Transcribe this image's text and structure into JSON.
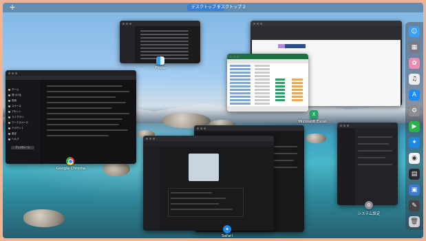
{
  "spaces_bar": {
    "add_label": "+",
    "tabs": [
      {
        "label": "デスクトップ 1",
        "active": true
      },
      {
        "label": "デスクトップ 2",
        "active": false
      }
    ]
  },
  "windows": {
    "finder": {
      "label": "Finder"
    },
    "excel": {
      "label": "Microsoft Excel"
    },
    "chrome": {
      "label": "Google Chrome"
    },
    "safari": {
      "label": "Safari"
    },
    "settings": {
      "label": "システム設定"
    }
  },
  "chrome_sidebar": {
    "items": [
      "ホーム",
      "見つける",
      "探索",
      "スペース",
      "アセット",
      "ライブラリ",
      "ワークスペース",
      "アカウント",
      "設定",
      "ヘルプ"
    ],
    "upgrade_label": "アップグレード"
  },
  "colors": {
    "accent": "#3b7fd4",
    "window_bg": "#1c1c1f",
    "frame": "#efb497",
    "excel_green": "#21a366",
    "excel_orange": "#f5a54a"
  },
  "dock": {
    "icons": [
      "finder-icon",
      "launchpad-icon",
      "photos-icon",
      "music-icon",
      "app-store-icon",
      "settings-icon",
      "facetime-icon",
      "safari-icon",
      "chrome-icon",
      "launcher-icon",
      "calendar-icon",
      "notes-icon",
      "trash-icon"
    ]
  }
}
